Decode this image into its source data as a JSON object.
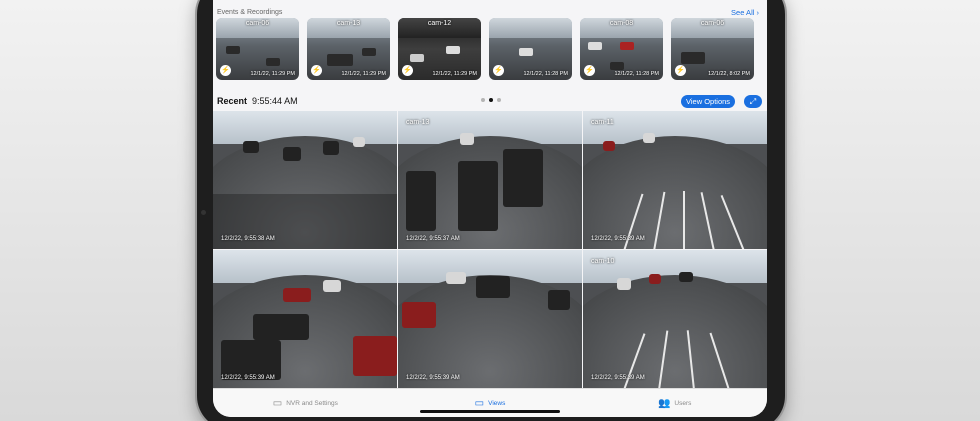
{
  "events": {
    "title": "Events & Recordings",
    "see_all": "See All",
    "thumbnails": [
      {
        "cam": "cam-06",
        "time": "12/1/22, 11:29 PM",
        "night": false
      },
      {
        "cam": "cam-13",
        "time": "12/1/22, 11:29 PM",
        "night": false
      },
      {
        "cam": "cam-12",
        "time": "12/1/22, 11:29 PM",
        "night": true
      },
      {
        "cam": "",
        "time": "12/1/22, 11:28 PM",
        "night": false
      },
      {
        "cam": "cam-08",
        "time": "12/1/22, 11:28 PM",
        "night": false
      },
      {
        "cam": "cam-06",
        "time": "12/1/22, 8:02 PM",
        "night": false
      }
    ]
  },
  "recent": {
    "label": "Recent",
    "time": "9:55:44 AM",
    "view_options": "View Options",
    "expand_icon": "expand-arrows-icon"
  },
  "tiles": [
    {
      "cam": "",
      "time": "12/2/22, 9:55:38 AM"
    },
    {
      "cam": "cam-13",
      "time": "12/2/22, 9:55:37 AM"
    },
    {
      "cam": "cam-11",
      "time": "12/2/22, 9:55:39 AM"
    },
    {
      "cam": "",
      "time": "12/2/22, 9:55:39 AM"
    },
    {
      "cam": "",
      "time": "12/2/22, 9:55:39 AM"
    },
    {
      "cam": "cam-10",
      "time": "12/2/22, 9:55:39 AM"
    }
  ],
  "tabbar": {
    "tabs": [
      {
        "label": "NVR and Settings",
        "icon": "nvr-icon",
        "active": false
      },
      {
        "label": "Views",
        "icon": "monitor-icon",
        "active": true
      },
      {
        "label": "Users",
        "icon": "users-icon",
        "active": false
      }
    ]
  },
  "colors": {
    "accent": "#1a6fe0"
  }
}
